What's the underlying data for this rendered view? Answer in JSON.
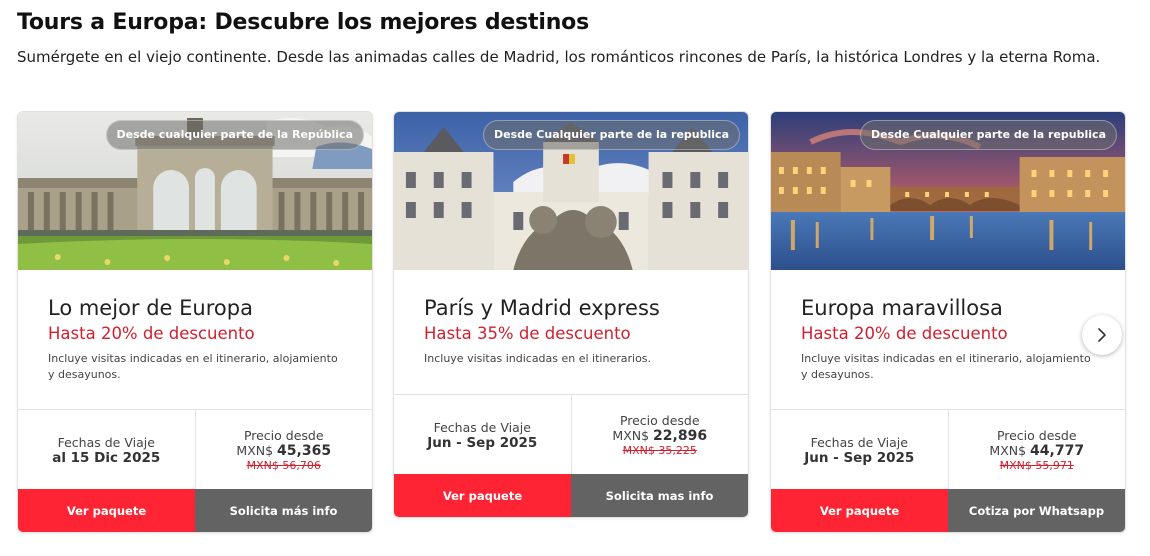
{
  "header": {
    "title": "Tours a Europa: Descubre los mejores destinos",
    "subtitle": "Sumérgete en el viejo continente. Desde las animadas calles de Madrid, los románticos rincones de París, la histórica Londres y la eterna Roma."
  },
  "cards": [
    {
      "origin": "Desde cualquier parte de la República",
      "name": "Lo mejor de Europa",
      "discount": "Hasta 20% de descuento",
      "includes": "Incluye visitas indicadas en el itinerario, alojamiento y desayunos.",
      "dates_label": "Fechas de Viaje",
      "dates_value": "al 15 Dic 2025",
      "price_label": "Precio desde",
      "currency": "MXN$",
      "price": "45,365",
      "old_price": "MXN$ 56,706",
      "primary_button": "Ver paquete",
      "secondary_button": "Solicita más info"
    },
    {
      "origin": "Desde Cualquier parte de la republica",
      "name": "París y Madrid express",
      "discount": "Hasta 35% de descuento",
      "includes": "Incluye visitas indicadas en el itinerarios.",
      "dates_label": "Fechas de Viaje",
      "dates_value": "Jun - Sep 2025",
      "price_label": "Precio desde",
      "currency": "MXN$",
      "price": "22,896",
      "old_price": "MXN$ 35,225",
      "primary_button": "Ver paquete",
      "secondary_button": "Solicita mas info"
    },
    {
      "origin": "Desde Cualquier parte de la republica",
      "name": "Europa maravillosa",
      "discount": "Hasta 20% de descuento",
      "includes": "Incluye visitas indicadas en el itinerario, alojamiento y desayunos.",
      "dates_label": "Fechas de Viaje",
      "dates_value": "Jun - Sep 2025",
      "price_label": "Precio desde",
      "currency": "MXN$",
      "price": "44,777",
      "old_price": "MXN$ 55,971",
      "primary_button": "Ver paquete",
      "secondary_button": "Cotiza por Whatsapp"
    }
  ],
  "carousel": {
    "next_icon": "chevron-right-icon"
  },
  "colors": {
    "accent_red": "#ff2433",
    "discount_red": "#d11f2e",
    "button_gray": "#636363"
  }
}
